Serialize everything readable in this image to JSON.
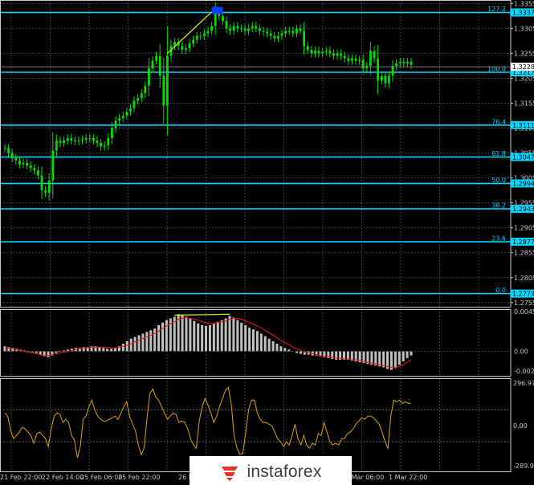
{
  "colors": {
    "background": "#000000",
    "grid": "#3a4450",
    "axis": "#c8c8c8",
    "candle": "#00e000",
    "fib_line": "#00d8ff",
    "fib_label": "#00d8ff",
    "price_tag_bg": "#00d8ff",
    "divergence": "#c8f000",
    "target_box": "#1040ff",
    "histogram": "#c0c0c0",
    "signal": "#e01818",
    "cci": "#e0a000",
    "cci_level": "#5a6470",
    "logo_red": "#e8332a"
  },
  "x_labels": [
    "21 Feb 22:00",
    "22 Feb 14:00",
    "25 Feb 06:00",
    "25 Feb 22:00",
    "26 Feb",
    "1 Mar 06:00",
    "1 Mar 22:00"
  ],
  "price_axis": {
    "ticks": [
      "1.3355",
      "1.3305",
      "1.3255",
      "1.3205",
      "1.3155",
      "1.3105",
      "1.3055",
      "1.3005",
      "1.2955",
      "1.2905",
      "1.2855",
      "1.2805",
      "1.2755"
    ]
  },
  "fib_levels": [
    {
      "level": "127.2",
      "price": "1.3337"
    },
    {
      "level": "100.0",
      "price": "1.3217"
    },
    {
      "level": "76.4",
      "price": "1.3111"
    },
    {
      "level": "61.8",
      "price": "1.3047"
    },
    {
      "level": "50.0",
      "price": "1.2994"
    },
    {
      "level": "38.2",
      "price": "1.2943"
    },
    {
      "level": "23.6",
      "price": "1.2877"
    },
    {
      "level": "0.0",
      "price": "1.2773"
    }
  ],
  "current_price": "1.3228",
  "macd_axis": {
    "ticks": [
      "0.00452",
      "0.00",
      "-0.00246"
    ]
  },
  "cci_axis": {
    "ticks": [
      "296.9756",
      "0.00",
      "-289.914"
    ]
  },
  "chart_data": [
    {
      "type": "candlestick",
      "title": "",
      "xlabel": "",
      "ylabel": "",
      "ylim": [
        1.2745,
        1.3362
      ],
      "close": [
        1.3065,
        1.3055,
        1.3045,
        1.304,
        1.3032,
        1.3035,
        1.303,
        1.3025,
        1.302,
        1.301,
        1.298,
        1.2975,
        1.3,
        1.306,
        1.308,
        1.3075,
        1.308,
        1.3085,
        1.308,
        1.3078,
        1.308,
        1.3082,
        1.3085,
        1.3085,
        1.308,
        1.3075,
        1.3068,
        1.307,
        1.3085,
        1.3105,
        1.312,
        1.3125,
        1.313,
        1.3138,
        1.3145,
        1.316,
        1.3165,
        1.3175,
        1.319,
        1.3225,
        1.324,
        1.325,
        1.321,
        1.315,
        1.325,
        1.327,
        1.3278,
        1.327,
        1.3262,
        1.3265,
        1.3275,
        1.3282,
        1.329,
        1.329,
        1.3295,
        1.33,
        1.331,
        1.334,
        1.333,
        1.332,
        1.3305,
        1.33,
        1.331,
        1.3305,
        1.3305,
        1.33,
        1.3305,
        1.331,
        1.3305,
        1.33,
        1.3298,
        1.3295,
        1.329,
        1.3285,
        1.329,
        1.3295,
        1.33,
        1.33,
        1.3295,
        1.3305,
        1.33,
        1.327,
        1.3262,
        1.3255,
        1.326,
        1.3255,
        1.3258,
        1.326,
        1.3255,
        1.325,
        1.3255,
        1.325,
        1.3245,
        1.324,
        1.3245,
        1.324,
        1.3242,
        1.3225,
        1.323,
        1.326,
        1.3245,
        1.32,
        1.321,
        1.3195,
        1.321,
        1.323,
        1.3235,
        1.3238,
        1.3235,
        1.3238,
        1.3232
      ],
      "high_point": 1.3345
    },
    {
      "type": "bar",
      "title": "",
      "ylim": [
        -0.003,
        0.005
      ],
      "series": [
        {
          "values": [
            0.0006,
            0.0005,
            0.0004,
            0.0003,
            0.0002,
            0.0001,
            0.0,
            -0.0001,
            -0.0002,
            -0.0004,
            -0.0006,
            -0.0007,
            -0.0005,
            -0.0002,
            0.0,
            0.0001,
            0.0002,
            0.0003,
            0.0004,
            0.0004,
            0.0005,
            0.0005,
            0.0006,
            0.0006,
            0.0005,
            0.0004,
            0.0003,
            0.0003,
            0.0004,
            0.0006,
            0.0009,
            0.0012,
            0.0015,
            0.0017,
            0.0019,
            0.0021,
            0.0023,
            0.0025,
            0.0027,
            0.0031,
            0.0034,
            0.0037,
            0.0039,
            0.0041,
            0.0044,
            0.0043,
            0.0041,
            0.0039,
            0.0036,
            0.0033,
            0.0031,
            0.003,
            0.0031,
            0.0033,
            0.0035,
            0.0037,
            0.0039,
            0.0042,
            0.004,
            0.0037,
            0.0034,
            0.0031,
            0.0028,
            0.0026,
            0.0024,
            0.0021,
            0.0018,
            0.0015,
            0.0012,
            0.0009,
            0.0006,
            0.0004,
            0.0002,
            0.0,
            -0.0002,
            -0.0003,
            -0.0004,
            -0.0004,
            -0.0005,
            -0.0005,
            -0.0006,
            -0.0007,
            -0.0008,
            -0.0009,
            -0.001,
            -0.001,
            -0.001,
            -0.001,
            -0.0011,
            -0.0012,
            -0.0013,
            -0.0014,
            -0.0015,
            -0.0016,
            -0.0017,
            -0.0018,
            -0.0019,
            -0.0021,
            -0.0022,
            -0.002,
            -0.0016,
            -0.0012,
            -0.0008,
            -0.0005
          ]
        },
        {
          "values": [
            0.0004,
            0.0004,
            0.0003,
            0.0002,
            0.0001,
            0.0,
            -0.0001,
            -0.0002,
            -0.0003,
            -0.0004,
            -0.0005,
            -0.0005,
            -0.0004,
            -0.0003,
            -0.0002,
            -0.0001,
            0.0,
            0.0001,
            0.0002,
            0.0003,
            0.0004,
            0.0004,
            0.0005,
            0.0005,
            0.0005,
            0.0005,
            0.0005,
            0.0004,
            0.0004,
            0.0005,
            0.0006,
            0.0007,
            0.0009,
            0.0011,
            0.0013,
            0.0015,
            0.0017,
            0.0019,
            0.0021,
            0.0024,
            0.0027,
            0.003,
            0.0033,
            0.0035,
            0.0038,
            0.0039,
            0.004,
            0.0039,
            0.0038,
            0.0037,
            0.0035,
            0.0034,
            0.0033,
            0.0033,
            0.0034,
            0.0035,
            0.0036,
            0.0038,
            0.0039,
            0.0039,
            0.0038,
            0.0036,
            0.0034,
            0.0032,
            0.003,
            0.0028,
            0.0025,
            0.0022,
            0.0019,
            0.0016,
            0.0013,
            0.001,
            0.0008,
            0.0005,
            0.0003,
            0.0001,
            -0.0001,
            -0.0002,
            -0.0003,
            -0.0004,
            -0.0005,
            -0.0006,
            -0.0006,
            -0.0007,
            -0.0008,
            -0.0008,
            -0.0009,
            -0.0009,
            -0.001,
            -0.001,
            -0.0011,
            -0.0012,
            -0.0013,
            -0.0014,
            -0.0015,
            -0.0016,
            -0.0017,
            -0.0018,
            -0.0019,
            -0.0019,
            -0.0018,
            -0.0016,
            -0.0013,
            -0.001
          ]
        }
      ]
    },
    {
      "type": "line",
      "title": "",
      "ylim": [
        -289.914,
        296.9756
      ],
      "series": [
        {
          "values": [
            80,
            60,
            -30,
            -80,
            -60,
            -40,
            -10,
            -20,
            -40,
            -60,
            -110,
            -50,
            -40,
            -60,
            -80,
            -130,
            -20,
            60,
            80,
            70,
            20,
            40,
            20,
            -60,
            -90,
            -200,
            -130,
            40,
            60,
            120,
            160,
            100,
            60,
            40,
            30,
            30,
            40,
            50,
            60,
            40,
            80,
            120,
            150,
            60,
            10,
            -30,
            -120,
            -180,
            -140,
            50,
            200,
            230,
            180,
            160,
            120,
            80,
            40,
            60,
            80,
            70,
            20,
            30,
            20,
            -20,
            -80,
            -120,
            -140,
            30,
            120,
            170,
            130,
            80,
            20,
            60,
            120,
            170,
            220,
            240,
            140,
            -60,
            -140,
            -180,
            -170,
            -40,
            100,
            160,
            160,
            80,
            40,
            20,
            20,
            10,
            0,
            -40,
            -80,
            -100,
            -130,
            -100,
            -120,
            -60,
            10,
            -80,
            -120,
            -60,
            -120,
            -140,
            -110,
            -120,
            -50,
            -60,
            20,
            -40,
            -100,
            -120,
            -110,
            -120,
            -80,
            -80,
            -50,
            -40,
            -20,
            10,
            30,
            50,
            40,
            60,
            60,
            50,
            30,
            10,
            -40,
            -100,
            -140,
            60,
            160,
            150,
            160,
            140,
            150,
            140,
            140
          ]
        }
      ]
    }
  ]
}
